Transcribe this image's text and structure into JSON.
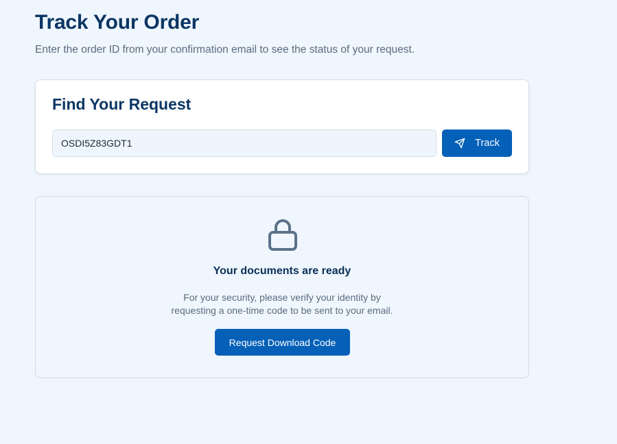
{
  "header": {
    "title": "Track Your Order",
    "subtitle": "Enter the order ID from your confirmation email to see the status of your request."
  },
  "find_request": {
    "title": "Find Your Request",
    "order_id_value": "OSDI5Z83GDT1",
    "track_label": "Track",
    "track_icon": "send-icon"
  },
  "documents": {
    "icon": "lock-icon",
    "title": "Your documents are ready",
    "description_line1": "For your security, please verify your identity by",
    "description_line2": "requesting a one-time code to be sent to your email.",
    "button_label": "Request Download Code"
  },
  "colors": {
    "background": "#eff6fd",
    "primary": "#0560b8",
    "heading": "#0b3563",
    "muted_text": "#5b6b7e",
    "icon": "#5b7289"
  }
}
